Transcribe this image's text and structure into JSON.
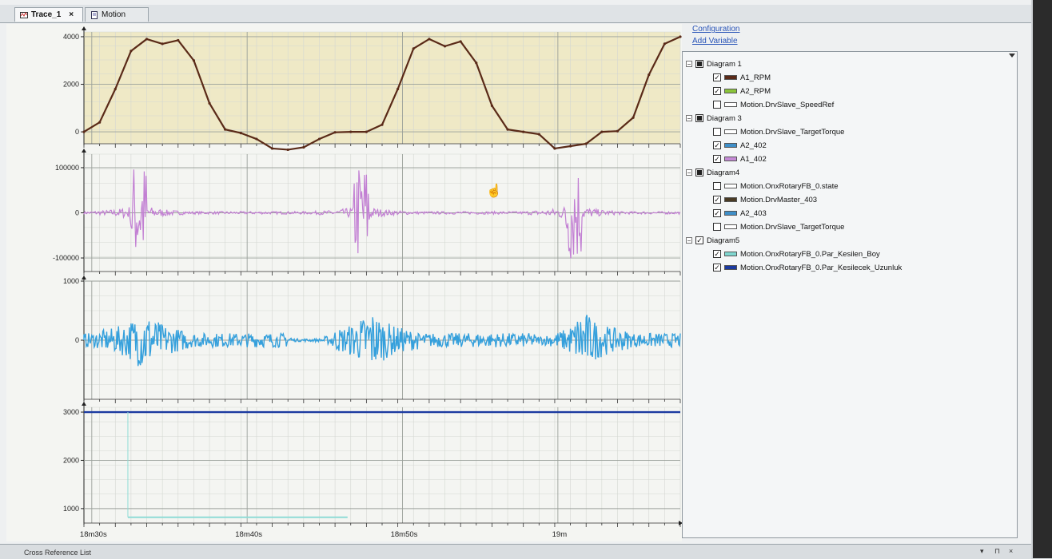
{
  "tabs": [
    {
      "label": "Trace_1",
      "active": true,
      "close": "×"
    },
    {
      "label": "Motion",
      "active": false
    }
  ],
  "links": {
    "configuration": "Configuration",
    "add_variable": "Add Variable"
  },
  "tree": [
    {
      "kind": "group",
      "label": "Diagram 1",
      "check": "mixed"
    },
    {
      "kind": "var",
      "label": "A1_RPM",
      "checked": true,
      "color": "#5a2a18"
    },
    {
      "kind": "var",
      "label": "A2_RPM",
      "checked": true,
      "color": "#8ac43a"
    },
    {
      "kind": "var",
      "label": "Motion.DrvSlave_SpeedRef",
      "checked": false,
      "color": "#ffffff"
    },
    {
      "kind": "group",
      "label": "Diagram 3",
      "check": "mixed"
    },
    {
      "kind": "var",
      "label": "Motion.DrvSlave_TargetTorque",
      "checked": false,
      "color": "#ffffff"
    },
    {
      "kind": "var",
      "label": "A2_402",
      "checked": true,
      "color": "#3f8fc8"
    },
    {
      "kind": "var",
      "label": "A1_402",
      "checked": true,
      "color": "#c58ad6"
    },
    {
      "kind": "group",
      "label": "Diagram4",
      "check": "mixed"
    },
    {
      "kind": "var",
      "label": "Motion.OnxRotaryFB_0.state",
      "checked": false,
      "color": "#ffffff"
    },
    {
      "kind": "var",
      "label": "Motion.DrvMaster_403",
      "checked": true,
      "color": "#4a3c26"
    },
    {
      "kind": "var",
      "label": "A2_403",
      "checked": true,
      "color": "#3f8fc8"
    },
    {
      "kind": "var",
      "label": "Motion.DrvSlave_TargetTorque",
      "checked": false,
      "color": "#ffffff"
    },
    {
      "kind": "group",
      "label": "Diagram5",
      "check": "checked"
    },
    {
      "kind": "var",
      "label": "Motion.OnxRotaryFB_0.Par_Kesilen_Boy",
      "checked": true,
      "color": "#7fd6cf"
    },
    {
      "kind": "var",
      "label": "Motion.OnxRotaryFB_0.Par_Kesilecek_Uzunluk",
      "checked": true,
      "color": "#1b3aa0"
    }
  ],
  "status": {
    "label": "Cross Reference List",
    "controls": [
      "▾",
      "⊓",
      "×"
    ]
  },
  "chart_data": [
    {
      "type": "line",
      "title": "",
      "ylim": [
        -500,
        4200
      ],
      "yticks": [
        0,
        2000,
        4000
      ],
      "x_axis": {
        "ticks": [
          "18m30s",
          "18m40s",
          "18m50s",
          "19m"
        ]
      },
      "series": [
        {
          "name": "A1_RPM",
          "color": "#5a2a18",
          "x": [
            0,
            1,
            2,
            3,
            4,
            5,
            6,
            7,
            8,
            9,
            10,
            11,
            12,
            13,
            14,
            15,
            16,
            17,
            18,
            19,
            20,
            21,
            22,
            23,
            24,
            25,
            26,
            27,
            28,
            29,
            30,
            31,
            32,
            33,
            34,
            35,
            36,
            37,
            38
          ],
          "values": [
            0,
            400,
            1800,
            3400,
            3900,
            3700,
            3850,
            3000,
            1200,
            100,
            -50,
            -300,
            -700,
            -750,
            -650,
            -300,
            -20,
            0,
            0,
            300,
            1800,
            3500,
            3900,
            3600,
            3800,
            2900,
            1100,
            100,
            0,
            -100,
            -700,
            -600,
            -500,
            0,
            30,
            600,
            2400,
            3700,
            4000
          ]
        }
      ]
    },
    {
      "type": "line",
      "title": "",
      "ylim": [
        -130000,
        130000
      ],
      "yticks": [
        -100000,
        0,
        100000
      ],
      "series": [
        {
          "name": "A1_402",
          "color": "#c27fd3"
        }
      ]
    },
    {
      "type": "line",
      "title": "",
      "ylim": [
        -1000,
        1000
      ],
      "yticks": [
        0,
        1000
      ],
      "series": [
        {
          "name": "A2_403",
          "color": "#35a0dc"
        }
      ]
    },
    {
      "type": "line",
      "title": "",
      "ylim": [
        700,
        3100
      ],
      "yticks": [
        1000,
        2000,
        3000
      ],
      "x_axis": {
        "ticks": [
          "18m30s",
          "18m40s",
          "18m50s",
          "19m"
        ]
      },
      "series": [
        {
          "name": "Motion.OnxRotaryFB_0.Par_Kesilecek_Uzunluk",
          "color": "#1b3aa0",
          "x": [
            0,
            38
          ],
          "values": [
            3000,
            3000
          ]
        },
        {
          "name": "Motion.OnxRotaryFB_0.Par_Kesilen_Boy",
          "color": "#8fdcd6",
          "x": [
            2.8,
            16.8
          ],
          "values": [
            820,
            820
          ]
        }
      ]
    }
  ]
}
